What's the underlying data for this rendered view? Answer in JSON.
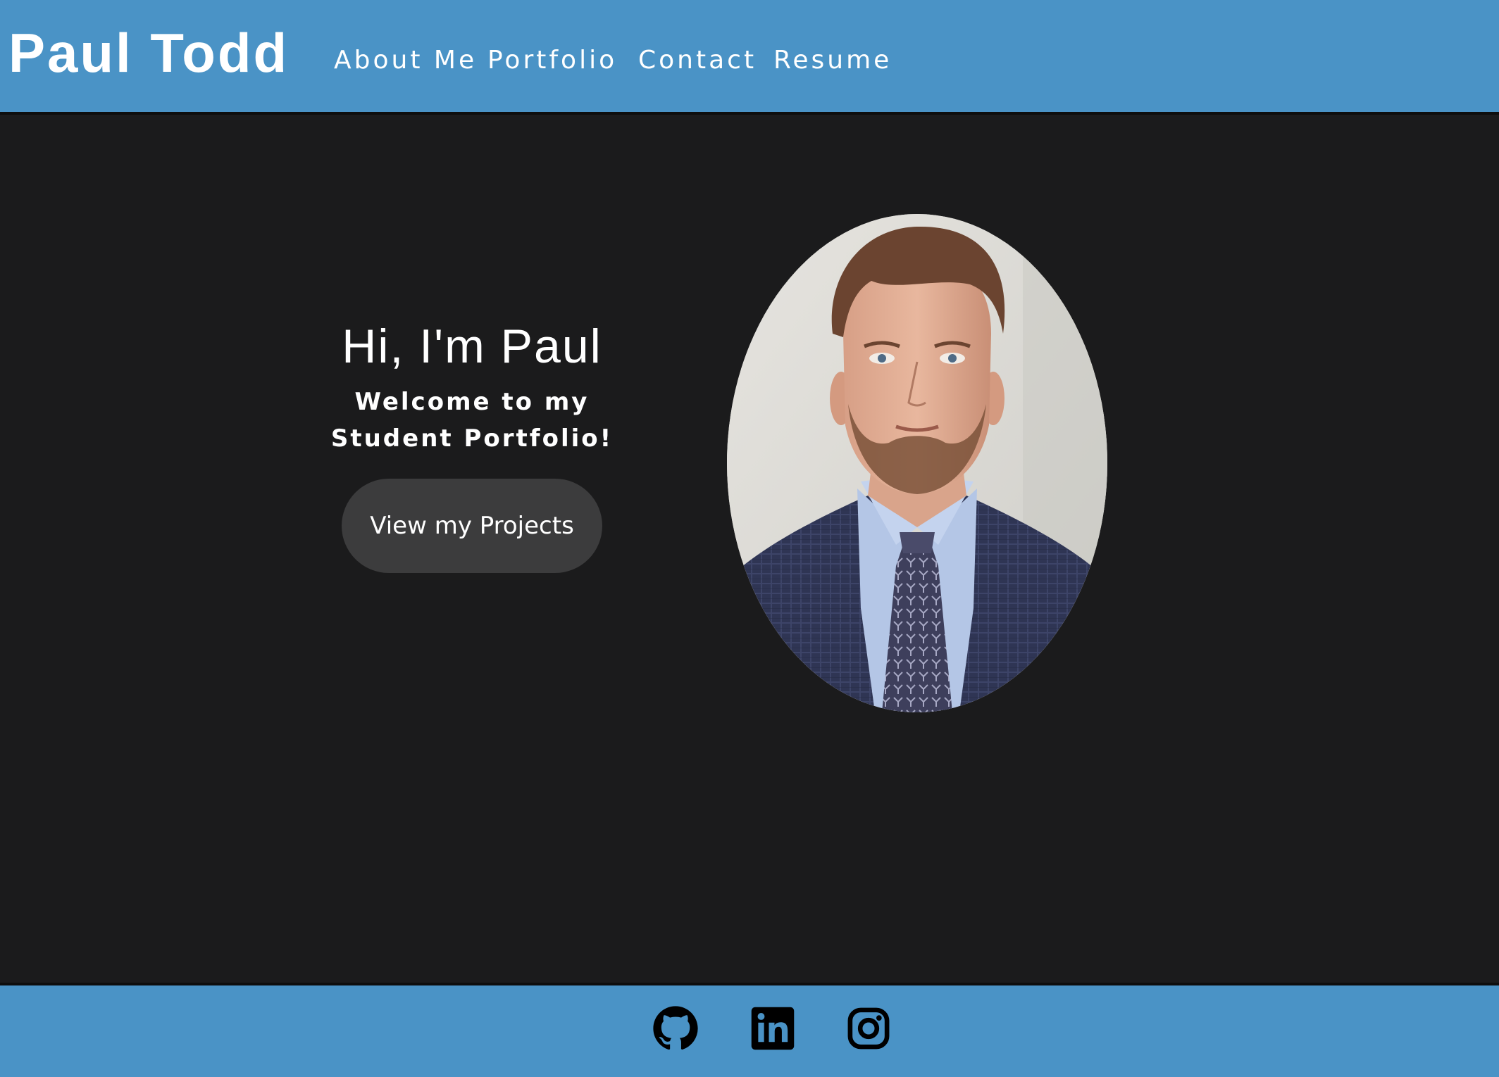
{
  "header": {
    "brand": "Paul Todd",
    "nav": [
      {
        "label": "About Me"
      },
      {
        "label": "Portfolio"
      },
      {
        "label": "Contact"
      },
      {
        "label": "Resume"
      }
    ]
  },
  "hero": {
    "title": "Hi, I'm Paul",
    "subtitle_line1": "Welcome to my",
    "subtitle_line2": "Student Portfolio!",
    "cta_label": "View my Projects"
  },
  "footer": {
    "social": [
      {
        "icon": "github-icon"
      },
      {
        "icon": "linkedin-icon"
      },
      {
        "icon": "instagram-icon"
      }
    ]
  },
  "colors": {
    "header_bg": "#4a93c6",
    "page_bg": "#1b1b1c",
    "button_bg": "#3c3c3d",
    "text": "#ffffff"
  }
}
